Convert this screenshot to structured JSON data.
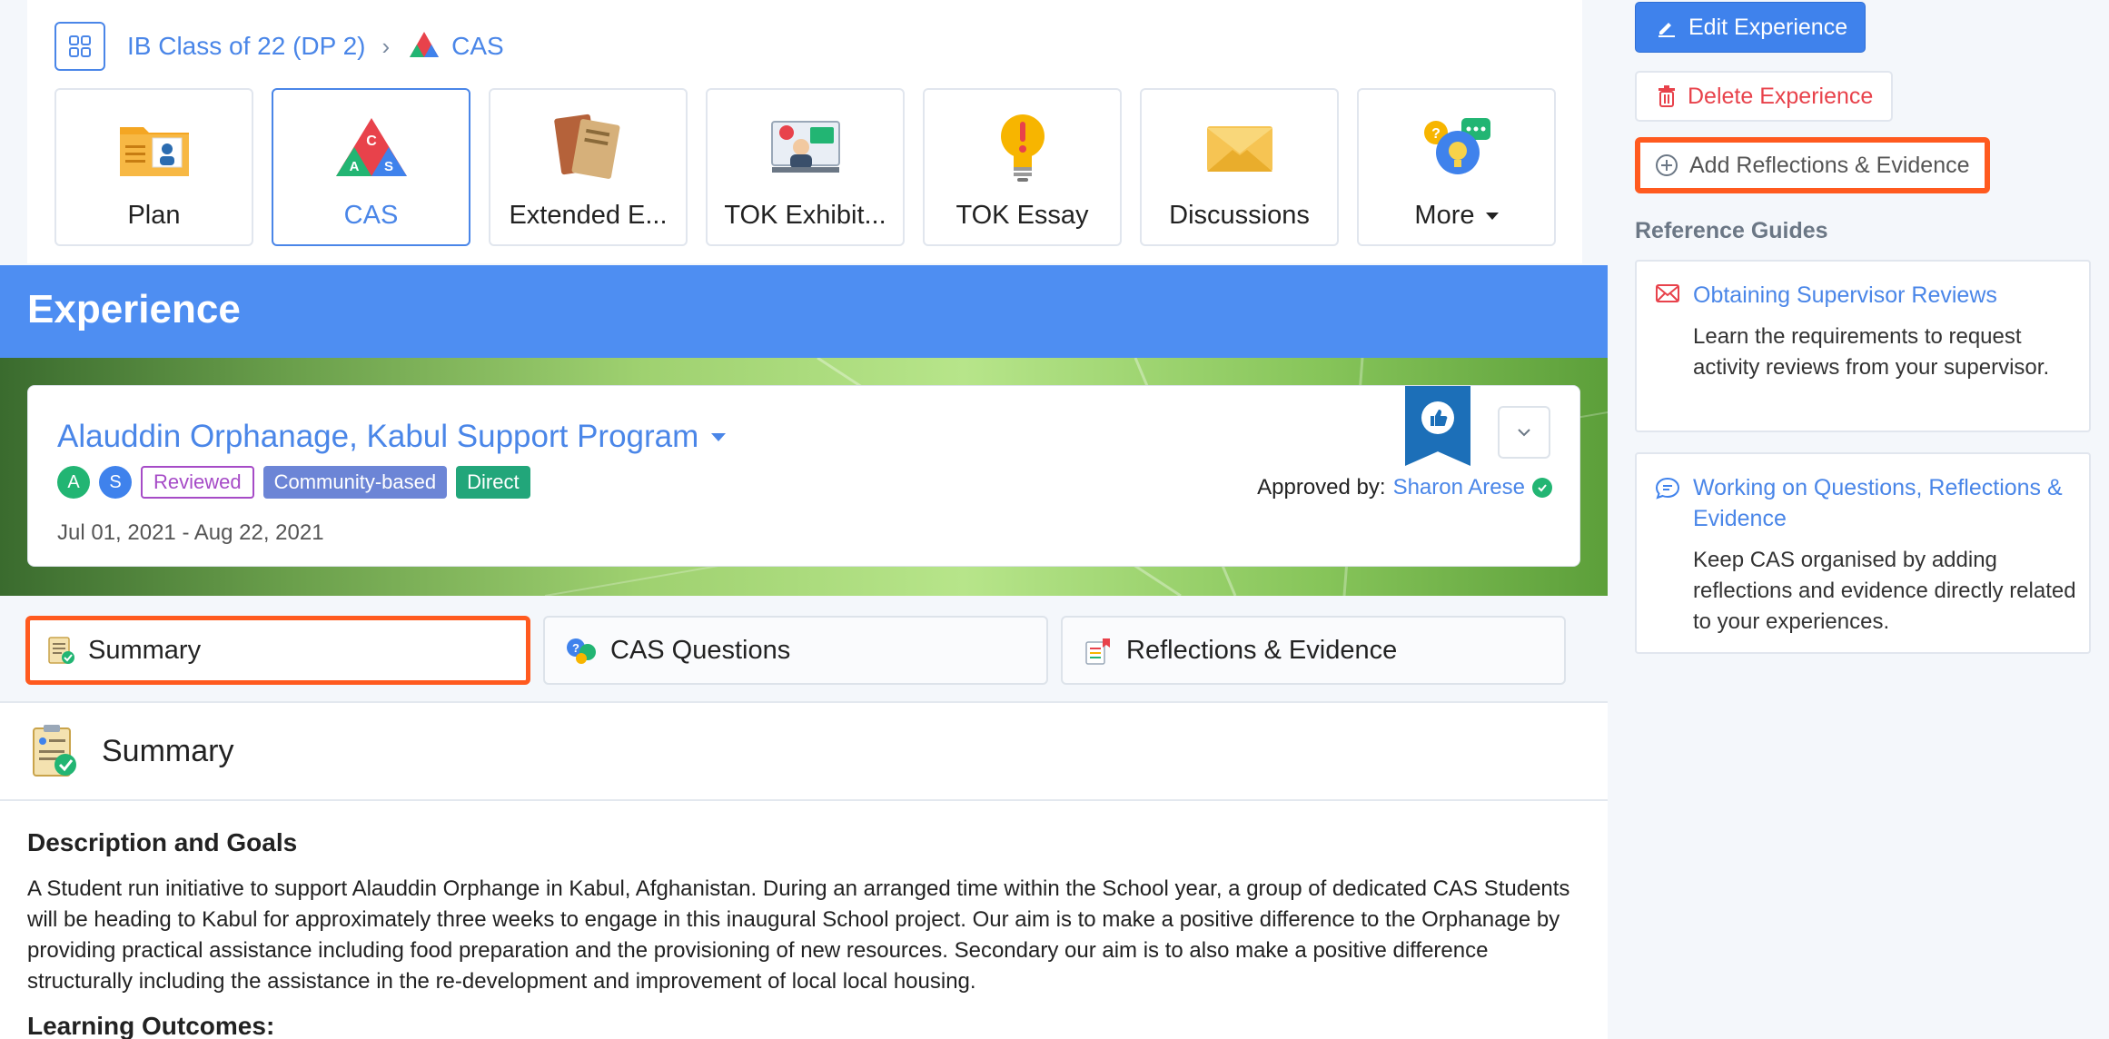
{
  "breadcrumb": {
    "class_name": "IB Class of 22 (DP 2)",
    "current": "CAS"
  },
  "tiles": [
    {
      "label": "Plan",
      "icon": "folder-plan-icon"
    },
    {
      "label": "CAS",
      "icon": "cas-triangle-icon",
      "active": true
    },
    {
      "label": "Extended E...",
      "icon": "books-icon"
    },
    {
      "label": "TOK Exhibit...",
      "icon": "presentation-icon"
    },
    {
      "label": "TOK Essay",
      "icon": "lightbulb-icon"
    },
    {
      "label": "Discussions",
      "icon": "envelope-icon"
    },
    {
      "label": "More",
      "icon": "chat-bulb-icon"
    }
  ],
  "experience": {
    "header": "Experience",
    "name": "Alauddin Orphanage, Kabul Support Program",
    "avatars": [
      "A",
      "S"
    ],
    "status_badge": "Reviewed",
    "type_badge": "Community-based",
    "mode_badge": "Direct",
    "dates": "Jul 01, 2021 - Aug 22, 2021",
    "approved_label": "Approved by:",
    "approved_by": "Sharon Arese"
  },
  "section_tabs": [
    {
      "label": "Summary",
      "active": true
    },
    {
      "label": "CAS Questions"
    },
    {
      "label": "Reflections & Evidence"
    }
  ],
  "summary": {
    "title": "Summary",
    "description_heading": "Description and Goals",
    "description": "A Student run initiative to support Alauddin Orphange in Kabul, Afghanistan. During an arranged time within the School year, a group of dedicated CAS Students will be heading to Kabul for approximately three weeks to engage in this inaugural School project. Our aim is to make a positive difference to the Orphanage by providing practical assistance including food preparation and the provisioning of new resources. Secondary our aim is to also make a positive difference structurally including the assistance in the re-development and improvement of local local housing.",
    "learning_outcomes_heading": "Learning Outcomes:"
  },
  "sidebar": {
    "edit_label": "Edit Experience",
    "delete_label": "Delete Experience",
    "add_label": "Add Reflections & Evidence",
    "reference_heading": "Reference Guides",
    "guides": [
      {
        "title": "Obtaining Supervisor Reviews",
        "description": "Learn the requirements to request activity reviews from your supervisor.",
        "icon": "envelope-outline-icon"
      },
      {
        "title": "Working on Questions, Reflections & Evidence",
        "description": "Keep CAS organised by adding reflections and evidence directly related to your experiences.",
        "icon": "chat-bubble-icon"
      }
    ]
  },
  "colors": {
    "accent": "#4a86e8",
    "banner": "#4e8ef2",
    "highlight": "#ff5a1f",
    "danger": "#e8424b"
  }
}
